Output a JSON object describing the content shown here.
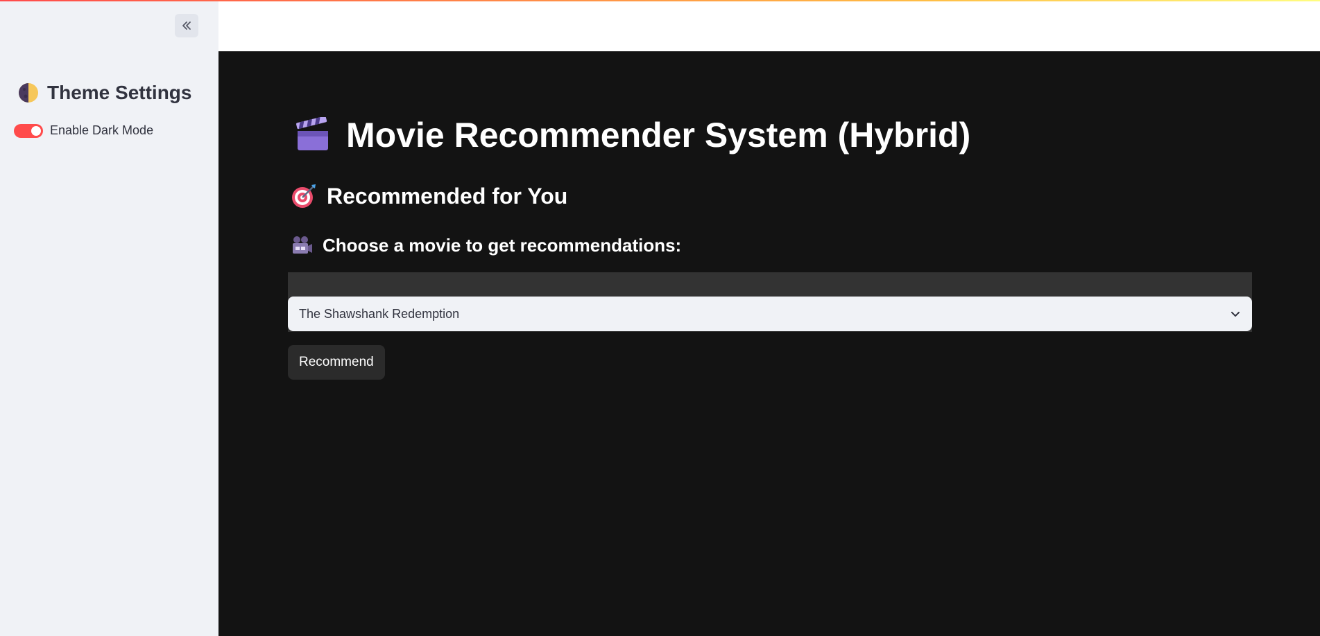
{
  "sidebar": {
    "title": "Theme Settings",
    "title_icon": "half-moon-icon",
    "toggle": {
      "label": "Enable Dark Mode",
      "checked": true
    },
    "collapse_icon": "double-chevron-left-icon"
  },
  "main": {
    "title": "Movie Recommender System (Hybrid)",
    "title_icon": "clapper-board-icon",
    "subtitle": "Recommended for You",
    "subtitle_icon": "target-icon",
    "prompt": "Choose a movie to get recommendations:",
    "prompt_icon": "movie-camera-icon",
    "movie_select": {
      "selected": "The Shawshank Redemption"
    },
    "recommend_button": "Recommend"
  },
  "colors": {
    "accent": "#ff4b4b",
    "sidebar_bg": "#f0f2f6",
    "main_bg": "#131313",
    "text_dark": "#31333f"
  }
}
